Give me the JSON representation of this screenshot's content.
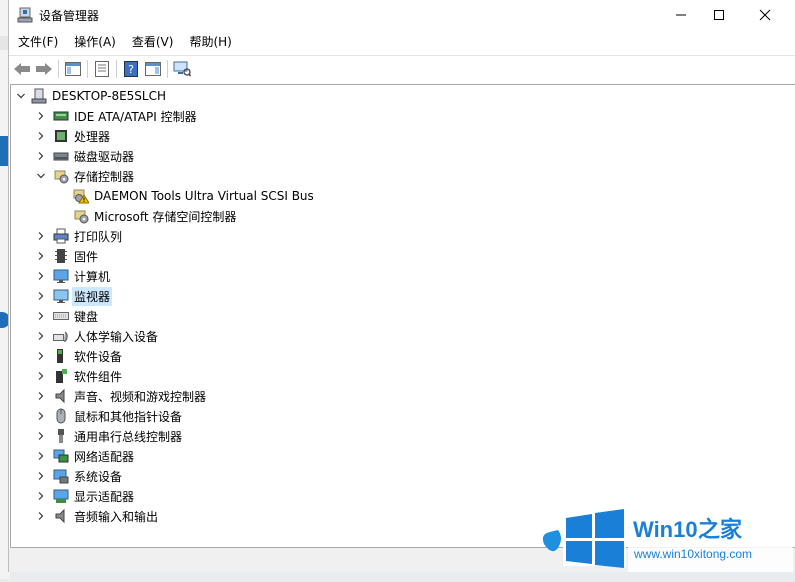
{
  "window": {
    "title": "设备管理器"
  },
  "controls": {
    "minimize": "minimize",
    "maximize": "maximize",
    "close": "close"
  },
  "menu": [
    "文件(F)",
    "操作(A)",
    "查看(V)",
    "帮助(H)"
  ],
  "toolbar": [
    "back-icon",
    "forward-icon",
    "show-hide-console-tree-icon",
    "properties-icon",
    "help-icon",
    "action-pane-icon",
    "scan-hardware-icon"
  ],
  "tree": {
    "root": "DESKTOP-8E5SLCH",
    "items": [
      {
        "label": "IDE ATA/ATAPI 控制器",
        "icon": "ide-controller-icon"
      },
      {
        "label": "处理器",
        "icon": "processor-icon"
      },
      {
        "label": "磁盘驱动器",
        "icon": "disk-drive-icon"
      },
      {
        "label": "存储控制器",
        "icon": "storage-controller-icon",
        "expanded": true,
        "children": [
          {
            "label": "DAEMON Tools Ultra Virtual SCSI Bus",
            "icon": "scsi-warning-icon"
          },
          {
            "label": "Microsoft 存储空间控制器",
            "icon": "storage-controller-icon"
          }
        ]
      },
      {
        "label": "打印队列",
        "icon": "printer-icon"
      },
      {
        "label": "固件",
        "icon": "firmware-icon"
      },
      {
        "label": "计算机",
        "icon": "computer-icon"
      },
      {
        "label": "监视器",
        "icon": "monitor-icon",
        "selected": true
      },
      {
        "label": "键盘",
        "icon": "keyboard-icon"
      },
      {
        "label": "人体学输入设备",
        "icon": "hid-icon"
      },
      {
        "label": "软件设备",
        "icon": "software-device-icon"
      },
      {
        "label": "软件组件",
        "icon": "software-component-icon"
      },
      {
        "label": "声音、视频和游戏控制器",
        "icon": "speaker-icon"
      },
      {
        "label": "鼠标和其他指针设备",
        "icon": "mouse-icon"
      },
      {
        "label": "通用串行总线控制器",
        "icon": "usb-icon"
      },
      {
        "label": "网络适配器",
        "icon": "network-adapter-icon"
      },
      {
        "label": "系统设备",
        "icon": "system-device-icon"
      },
      {
        "label": "显示适配器",
        "icon": "display-adapter-icon"
      },
      {
        "label": "音频输入和输出",
        "icon": "audio-io-icon"
      }
    ]
  },
  "watermark": {
    "brand": "Win10",
    "brand_suffix": "之家",
    "url": "www.win10xitong.com"
  }
}
